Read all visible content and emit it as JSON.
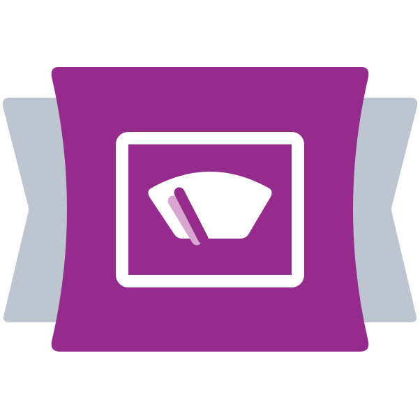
{
  "icon": {
    "name": "gauge-dashboard-icon",
    "colors": {
      "background": "#ffffff",
      "ribbon": "#bcc5d0",
      "banner": "#952c8d",
      "foreground": "#ffffff",
      "needle_shadow": "#d7a7d2"
    }
  }
}
